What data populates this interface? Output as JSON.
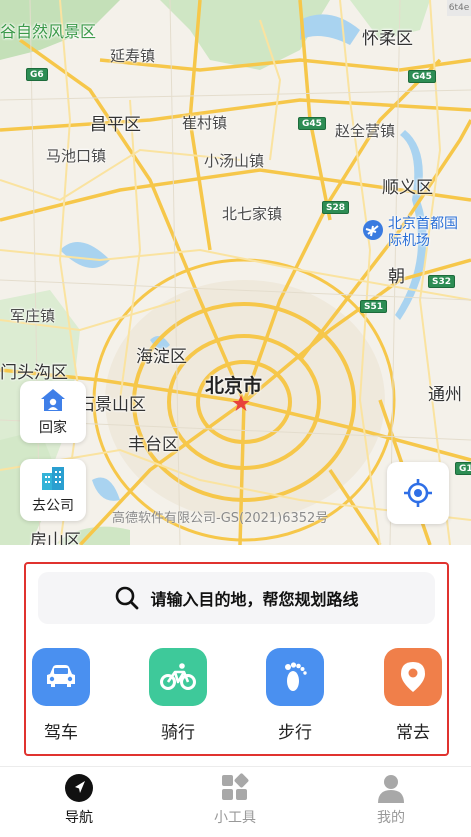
{
  "map": {
    "places": {
      "nature_area": "谷自然风景区",
      "yanshou": "延寿镇",
      "huairou": "怀柔区",
      "changping": "昌平区",
      "cuicun": "崔村镇",
      "zhaoquanying": "赵全营镇",
      "machikou": "马池口镇",
      "xiaotangshan": "小汤山镇",
      "shunyi": "顺义区",
      "beiqijia": "北七家镇",
      "airport": "北京首都国际机场",
      "junzhuang": "军庄镇",
      "haidian": "海淀区",
      "mentougou": "门头沟区",
      "beijing": "北京市",
      "shijingshan": "石景山区",
      "tongzhou": "通州",
      "fengtai": "丰台区",
      "fangshan": "房山区",
      "chao": "朝"
    },
    "shields": {
      "g6": "G6",
      "g45_top": "G45",
      "g45_mid": "G45",
      "s28": "S28",
      "s32": "S32",
      "s51": "S51",
      "g1": "G1"
    },
    "top_right_tag": "6t4e",
    "copyright": "高德软件有限公司-GS(2021)6352号",
    "quick": {
      "home_label": "回家",
      "company_label": "去公司"
    }
  },
  "panel": {
    "search_placeholder": "请输入目的地，帮您规划路线",
    "modes": [
      {
        "label": "驾车",
        "color": "#4a90f0",
        "icon": "car-icon"
      },
      {
        "label": "骑行",
        "color": "#3ec99a",
        "icon": "bicycle-icon"
      },
      {
        "label": "步行",
        "color": "#4a90f0",
        "icon": "footprint-icon"
      },
      {
        "label": "常去",
        "color": "#f07f4a",
        "icon": "location-pin-icon"
      }
    ]
  },
  "tabs": [
    {
      "label": "导航",
      "active": true,
      "icon": "navigation-arrow-icon"
    },
    {
      "label": "小工具",
      "active": false,
      "icon": "tools-grid-icon"
    },
    {
      "label": "我的",
      "active": false,
      "icon": "user-icon"
    }
  ],
  "colors": {
    "accent": "#4a90f0",
    "highlight_border": "#e0332f",
    "road": "#f6c74a",
    "tab_active": "#111111",
    "tab_inactive": "#999999"
  }
}
